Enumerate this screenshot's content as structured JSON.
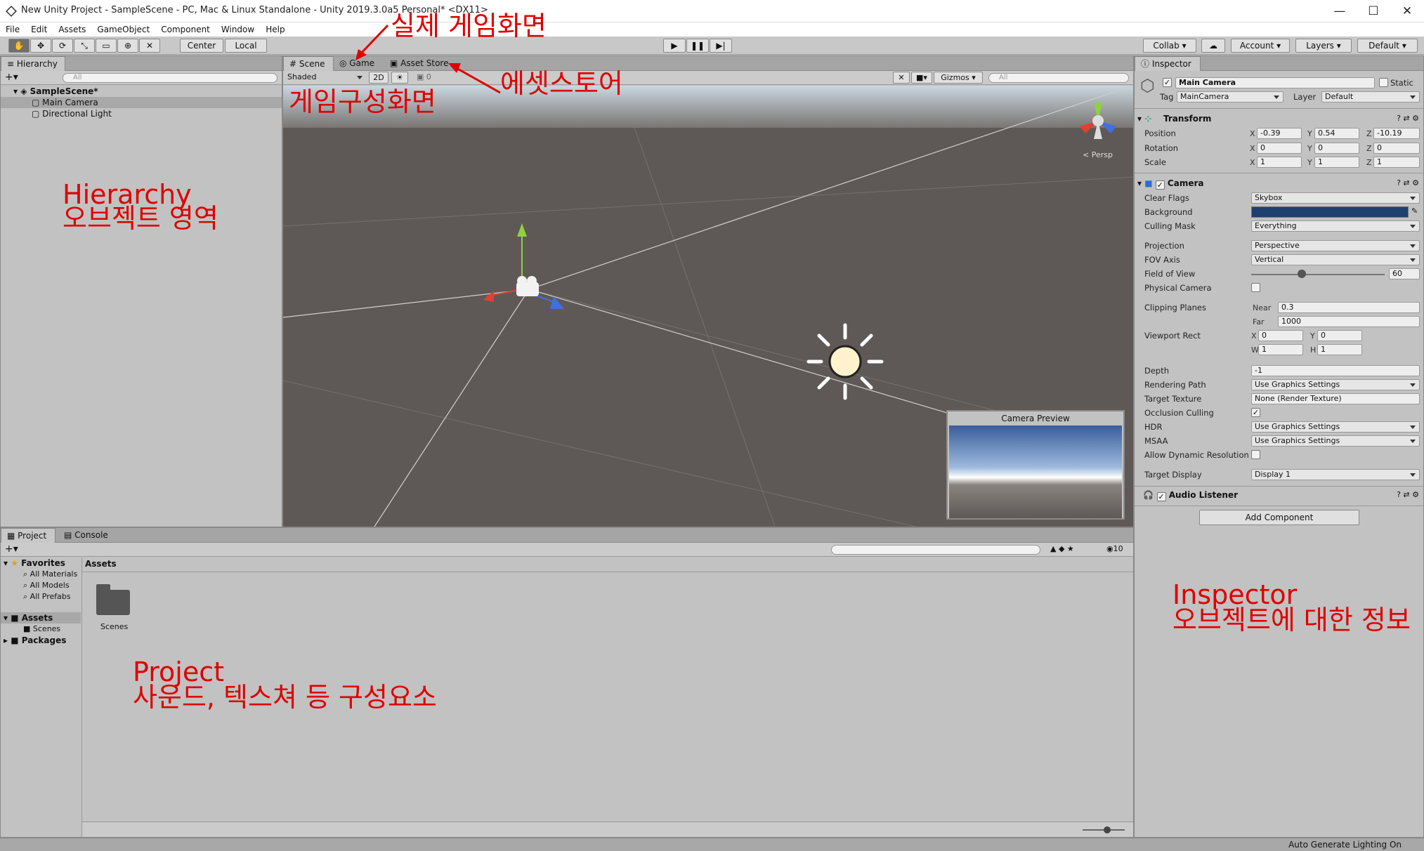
{
  "window": {
    "title": "New Unity Project - SampleScene - PC, Mac & Linux Standalone - Unity 2019.3.0a5 Personal* <DX11>",
    "minimize": "—",
    "maximize": "☐",
    "close": "✕"
  },
  "menu": [
    "File",
    "Edit",
    "Assets",
    "GameObject",
    "Component",
    "Window",
    "Help"
  ],
  "toolbar": {
    "center": "Center",
    "local": "Local",
    "collab": "Collab",
    "account": "Account",
    "layers": "Layers",
    "layout": "Default"
  },
  "hierarchy": {
    "tab": "Hierarchy",
    "search": "All",
    "scene": "SampleScene*",
    "items": [
      "Main Camera",
      "Directional Light"
    ]
  },
  "scene": {
    "tabs": [
      "Scene",
      "Game",
      "Asset Store"
    ],
    "shading": "Shaded",
    "mode2d": "2D",
    "fx_count": "0",
    "gizmos": "Gizmos",
    "search": "All",
    "persp": "Persp",
    "preview_title": "Camera Preview"
  },
  "project": {
    "tabs": [
      "Project",
      "Console"
    ],
    "count": "10",
    "favorites": {
      "label": "Favorites",
      "items": [
        "All Materials",
        "All Models",
        "All Prefabs"
      ]
    },
    "assets": {
      "label": "Assets",
      "items": [
        "Scenes"
      ]
    },
    "packages": "Packages",
    "breadcrumb": "Assets",
    "folder": "Scenes"
  },
  "inspector": {
    "tab": "Inspector",
    "object": "Main Camera",
    "static": "Static",
    "tag_label": "Tag",
    "tag": "MainCamera",
    "layer_label": "Layer",
    "layer": "Default",
    "transform": {
      "title": "Transform",
      "rows": [
        {
          "label": "Position",
          "x": "-0.39",
          "y": "0.54",
          "z": "-10.19"
        },
        {
          "label": "Rotation",
          "x": "0",
          "y": "0",
          "z": "0"
        },
        {
          "label": "Scale",
          "x": "1",
          "y": "1",
          "z": "1"
        }
      ]
    },
    "camera": {
      "title": "Camera",
      "clear_flags_label": "Clear Flags",
      "clear_flags": "Skybox",
      "background_label": "Background",
      "culling_label": "Culling Mask",
      "culling": "Everything",
      "projection_label": "Projection",
      "projection": "Perspective",
      "fov_axis_label": "FOV Axis",
      "fov_axis": "Vertical",
      "fov_label": "Field of View",
      "fov": "60",
      "fov_fraction": 0.38,
      "physical_label": "Physical Camera",
      "clipping_label": "Clipping Planes",
      "near_label": "Near",
      "near": "0.3",
      "far_label": "Far",
      "far": "1000",
      "viewport_label": "Viewport Rect",
      "vx": "0",
      "vy": "0",
      "vw": "1",
      "vh": "1",
      "depth_label": "Depth",
      "depth": "-1",
      "rendering_label": "Rendering Path",
      "rendering": "Use Graphics Settings",
      "target_tex_label": "Target Texture",
      "target_tex": "None (Render Texture)",
      "occlusion_label": "Occlusion Culling",
      "hdr_label": "HDR",
      "hdr": "Use Graphics Settings",
      "msaa_label": "MSAA",
      "msaa": "Use Graphics Settings",
      "dyn_res_label": "Allow Dynamic Resolution",
      "target_display_label": "Target Display",
      "target_display": "Display 1",
      "background_color": "#1f3f6e"
    },
    "audio": {
      "title": "Audio Listener"
    },
    "add_component": "Add Component"
  },
  "status": "Auto Generate Lighting On",
  "annotations": {
    "game": "실제 게임화면",
    "asset_store": "에셋스토어",
    "scene": "게임구성화면",
    "hierarchy_1": "Hierarchy",
    "hierarchy_2": "오브젝트 영역",
    "project_1": "Project",
    "project_2": "사운드, 텍스쳐 등 구성요소",
    "inspector_1": "Inspector",
    "inspector_2": "오브젝트에 대한 정보"
  },
  "colors": {
    "annotation": "#e00000",
    "scene_bg": "#5e5956"
  }
}
